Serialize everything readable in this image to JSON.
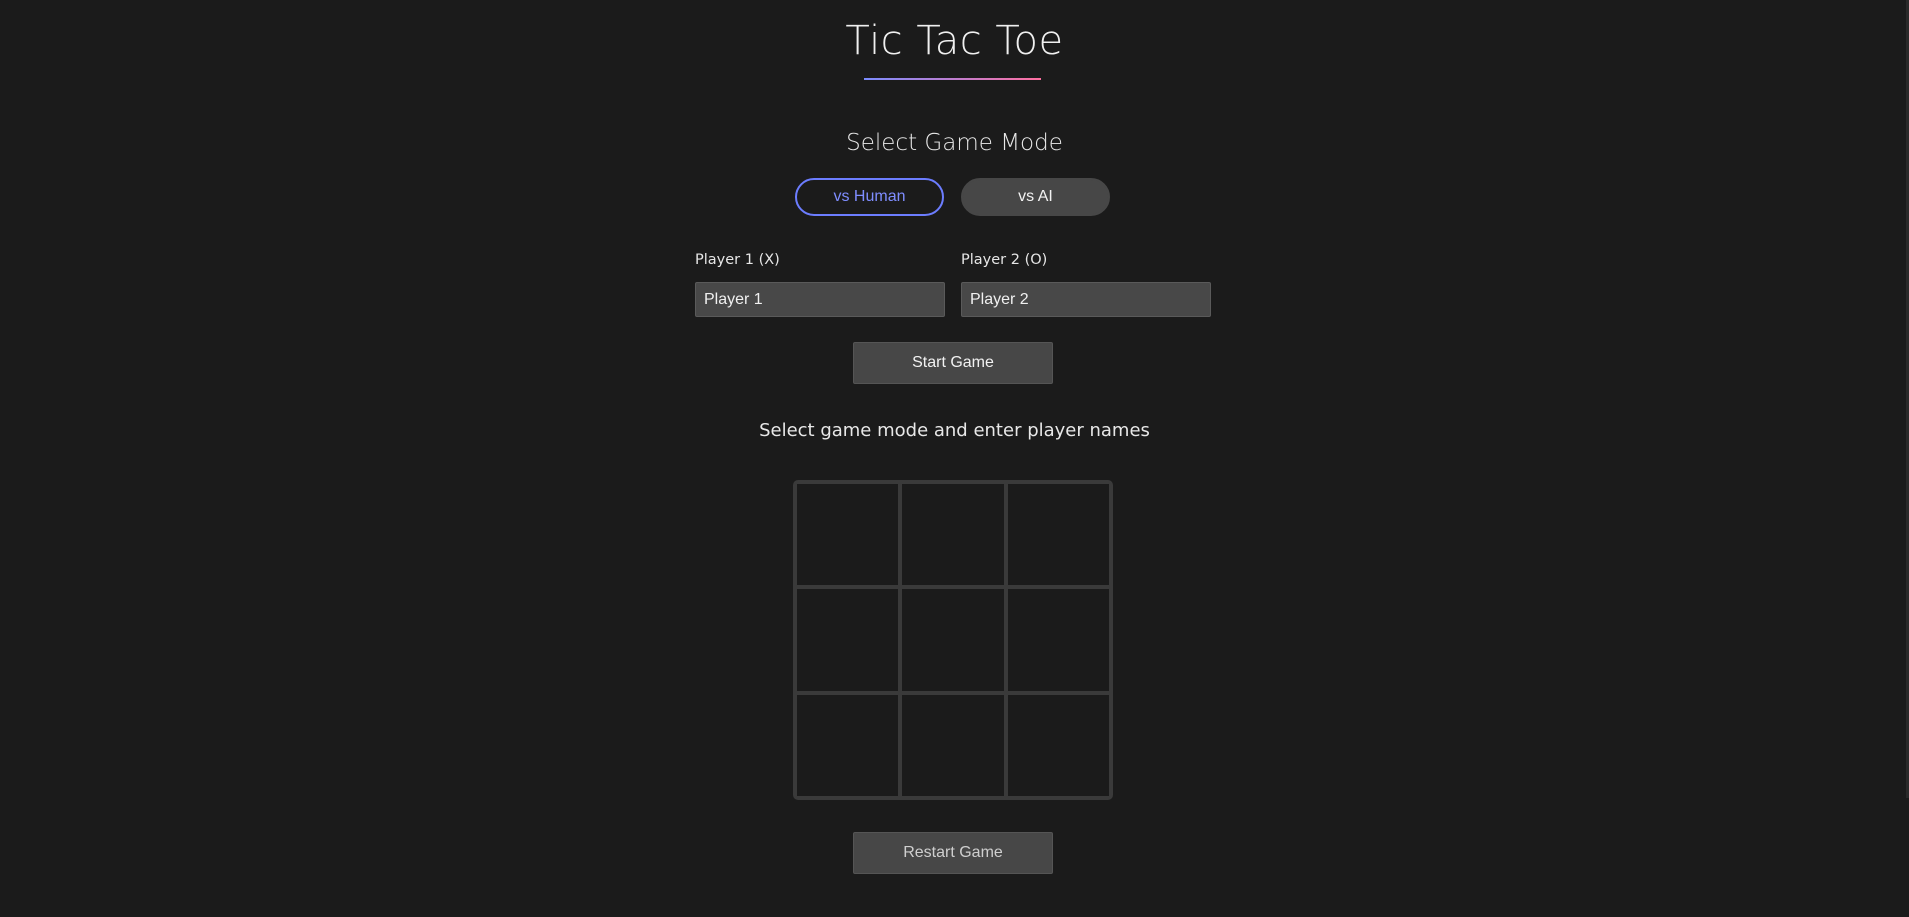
{
  "header": {
    "title": "Tic Tac Toe"
  },
  "mode": {
    "heading": "Select Game Mode",
    "options": [
      {
        "label": "vs Human",
        "selected": true
      },
      {
        "label": "vs AI",
        "selected": false
      }
    ]
  },
  "players": {
    "player1": {
      "label": "Player 1 (X)",
      "value": "Player 1"
    },
    "player2": {
      "label": "Player 2 (O)",
      "value": "Player 2"
    }
  },
  "actions": {
    "start_label": "Start Game",
    "restart_label": "Restart Game"
  },
  "status": {
    "message": "Select game mode and enter player names"
  },
  "board": {
    "cells": [
      "",
      "",
      "",
      "",
      "",
      "",
      "",
      "",
      ""
    ]
  },
  "colors": {
    "background": "#1b1b1b",
    "accent": "#6c7dff",
    "gradient_end": "#ff6fa0",
    "button": "#474747",
    "grid_line": "#3a3a3a"
  }
}
